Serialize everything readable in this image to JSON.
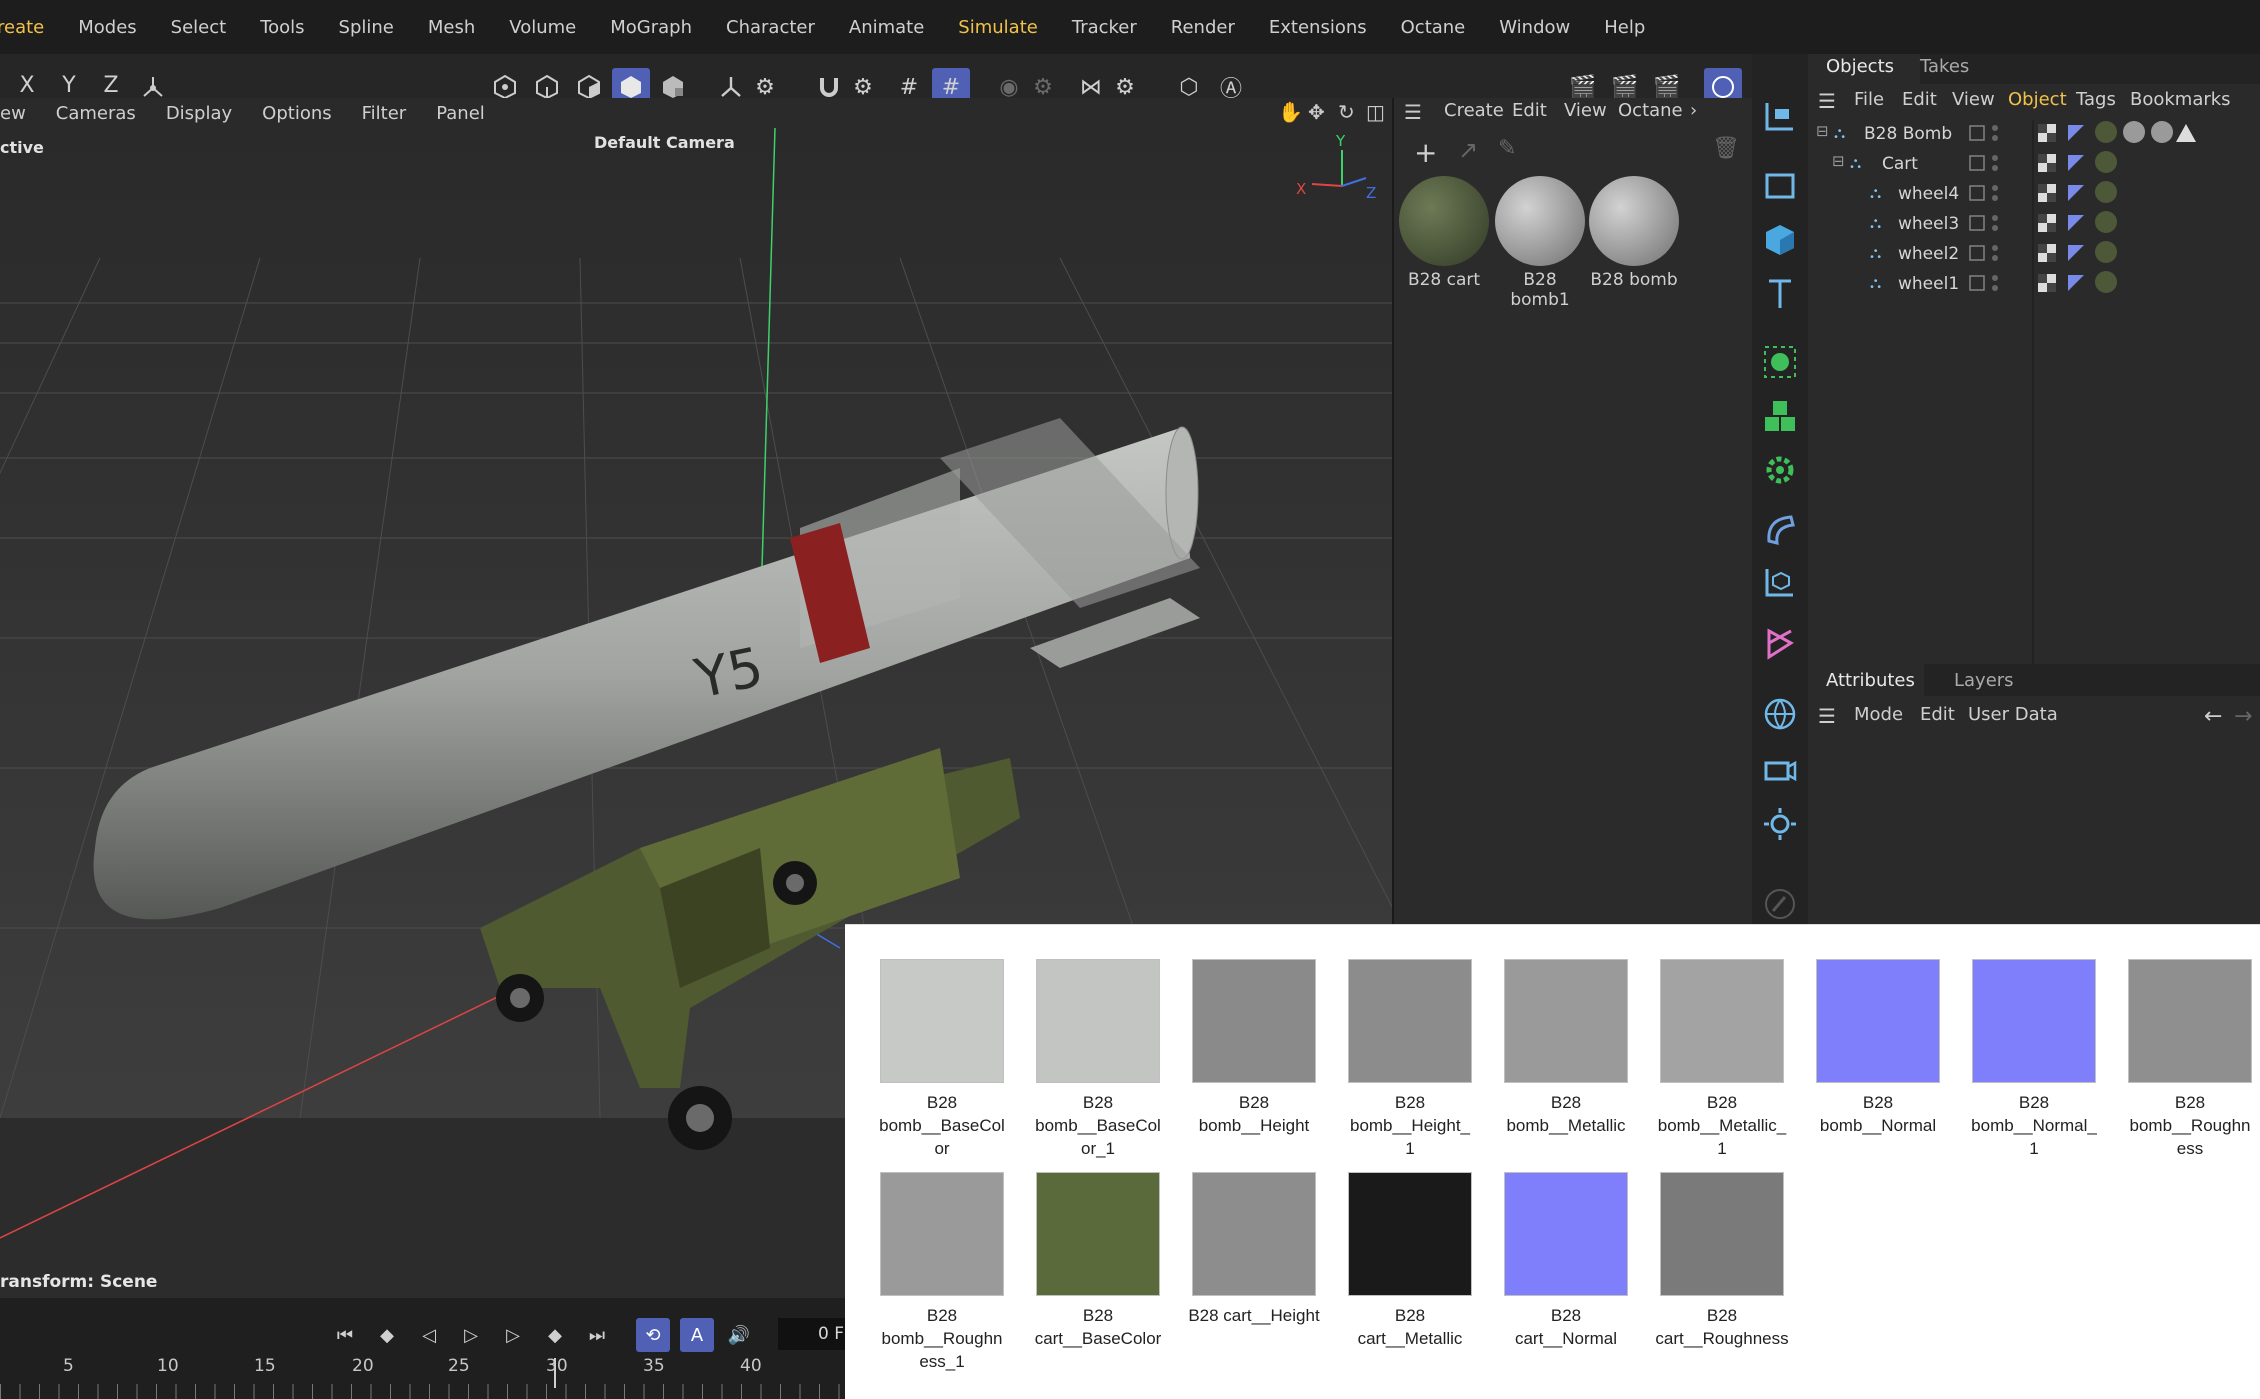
{
  "menubar": {
    "items": [
      "reate",
      "Modes",
      "Select",
      "Tools",
      "Spline",
      "Mesh",
      "Volume",
      "MoGraph",
      "Character",
      "Animate",
      "Simulate",
      "Tracker",
      "Render",
      "Extensions",
      "Octane",
      "Window",
      "Help"
    ],
    "highlighted": "Simulate"
  },
  "toolbar": {
    "axis_x": "X",
    "axis_y": "Y",
    "axis_z": "Z"
  },
  "viewport_menu": {
    "items": [
      "ew",
      "Cameras",
      "Display",
      "Options",
      "Filter",
      "Panel"
    ]
  },
  "viewport": {
    "mode_label": "ctive",
    "camera_label": "Default Camera",
    "transform_label": "ransform: Scene",
    "axis_y": "Y",
    "axis_x": "X",
    "axis_z": "Z",
    "bomb_text": "Y5"
  },
  "timeline": {
    "frame_value": "0 F",
    "ruler": [
      "5",
      "10",
      "15",
      "20",
      "25",
      "30",
      "35",
      "40"
    ]
  },
  "material_manager": {
    "menu": [
      "Create",
      "Edit",
      "View",
      "Octane"
    ],
    "materials": [
      {
        "name": "B28 cart",
        "color": "#4a5538"
      },
      {
        "name": "B28 bomb1",
        "color": "#8a8a8a"
      },
      {
        "name": "B28 bomb",
        "color": "#8a8a8a"
      }
    ]
  },
  "objects_panel": {
    "tabs": [
      "Objects",
      "Takes"
    ],
    "menu": [
      "File",
      "Edit",
      "View",
      "Object",
      "Tags",
      "Bookmarks"
    ],
    "active_menu": "Object",
    "rows": [
      {
        "name": "B28 Bomb",
        "indent": 0
      },
      {
        "name": "Cart",
        "indent": 1
      },
      {
        "name": "wheel4",
        "indent": 2
      },
      {
        "name": "wheel3",
        "indent": 2
      },
      {
        "name": "wheel2",
        "indent": 2
      },
      {
        "name": "wheel1",
        "indent": 2
      }
    ]
  },
  "attributes_panel": {
    "tabs": [
      "Attributes",
      "Layers"
    ],
    "menu": [
      "Mode",
      "Edit",
      "User Data"
    ]
  },
  "explorer": {
    "files": [
      {
        "label": "B28 bomb__BaseColor",
        "lines": [
          "B28",
          "bomb__BaseCol",
          "or"
        ],
        "color": "#c6c9c6"
      },
      {
        "label": "B28 bomb__BaseColor_1",
        "lines": [
          "B28",
          "bomb__BaseCol",
          "or_1"
        ],
        "color": "#c2c5c2"
      },
      {
        "label": "B28 bomb__Height",
        "lines": [
          "B28",
          "bomb__Height"
        ],
        "color": "#8a8a8a"
      },
      {
        "label": "B28 bomb__Height_1",
        "lines": [
          "B28",
          "bomb__Height_",
          "1"
        ],
        "color": "#8c8c8c"
      },
      {
        "label": "B28 bomb__Metallic",
        "lines": [
          "B28",
          "bomb__Metallic"
        ],
        "color": "#9a9a9a"
      },
      {
        "label": "B28 bomb__Metallic_1",
        "lines": [
          "B28",
          "bomb__Metallic_",
          "1"
        ],
        "color": "#a3a3a3"
      },
      {
        "label": "B28 bomb__Normal",
        "lines": [
          "B28",
          "bomb__Normal"
        ],
        "color": "#7f7ffb"
      },
      {
        "label": "B28 bomb__Normal_1",
        "lines": [
          "B28",
          "bomb__Normal_",
          "1"
        ],
        "color": "#7f7ffb"
      },
      {
        "label": "B28 bomb__Roughness",
        "lines": [
          "B28",
          "bomb__Roughn",
          "ess"
        ],
        "color": "#8f8f8f"
      },
      {
        "label": "B28 bomb__Roughness_1",
        "lines": [
          "B28",
          "bomb__Roughn",
          "ess_1"
        ],
        "color": "#9a9a9a"
      },
      {
        "label": "B28 cart__BaseColor",
        "lines": [
          "B28",
          "cart__BaseColor"
        ],
        "color": "#5a6a3a"
      },
      {
        "label": "B28 cart__Height",
        "lines": [
          "B28 cart__Height"
        ],
        "color": "#8d8d8d"
      },
      {
        "label": "B28 cart__Metallic",
        "lines": [
          "B28",
          "cart__Metallic"
        ],
        "color": "#1a1a1a"
      },
      {
        "label": "B28 cart__Normal",
        "lines": [
          "B28",
          "cart__Normal"
        ],
        "color": "#7f7ffb"
      },
      {
        "label": "B28 cart__Roughness",
        "lines": [
          "B28",
          "cart__Roughness"
        ],
        "color": "#7a7a7a"
      }
    ]
  },
  "colors": {
    "accent": "#5061b5",
    "highlight": "#f1c24a",
    "selected_menu": "#f1c24a"
  }
}
